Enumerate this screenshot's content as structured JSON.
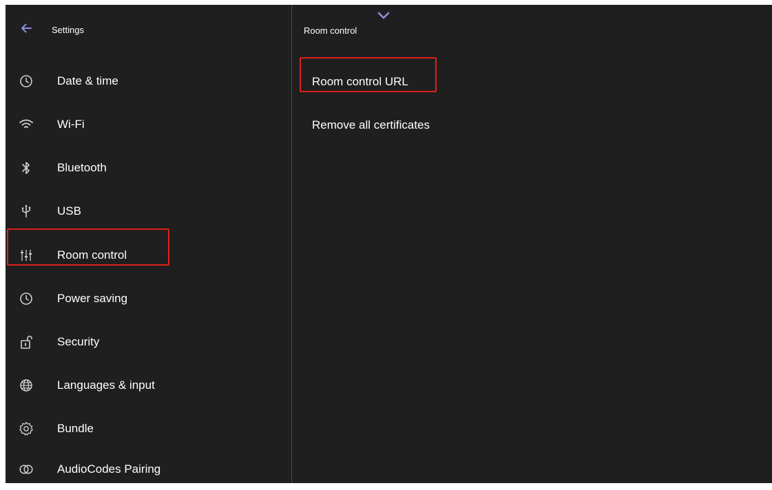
{
  "sidebar": {
    "title": "Settings",
    "items": [
      {
        "label": "Date & time",
        "icon": "clock-icon"
      },
      {
        "label": "Wi-Fi",
        "icon": "wifi-icon"
      },
      {
        "label": "Bluetooth",
        "icon": "bluetooth-icon"
      },
      {
        "label": "USB",
        "icon": "usb-icon"
      },
      {
        "label": "Room control",
        "icon": "sliders-icon",
        "selected": true
      },
      {
        "label": "Power saving",
        "icon": "clock-icon"
      },
      {
        "label": "Security",
        "icon": "unlock-icon"
      },
      {
        "label": "Languages & input",
        "icon": "globe-icon"
      },
      {
        "label": "Bundle",
        "icon": "gear-icon"
      },
      {
        "label": "AudioCodes Pairing",
        "icon": "pairing-icon"
      }
    ]
  },
  "main": {
    "title": "Room control",
    "items": [
      {
        "label": "Room control URL",
        "highlighted": true
      },
      {
        "label": "Remove all certificates"
      }
    ]
  },
  "colors": {
    "background": "#1f1f1f",
    "text": "#ffffff",
    "icon": "#d0d0d0",
    "accent": "#8a8fe0",
    "highlight": "#e0201a",
    "divider": "#4a4a4a"
  }
}
